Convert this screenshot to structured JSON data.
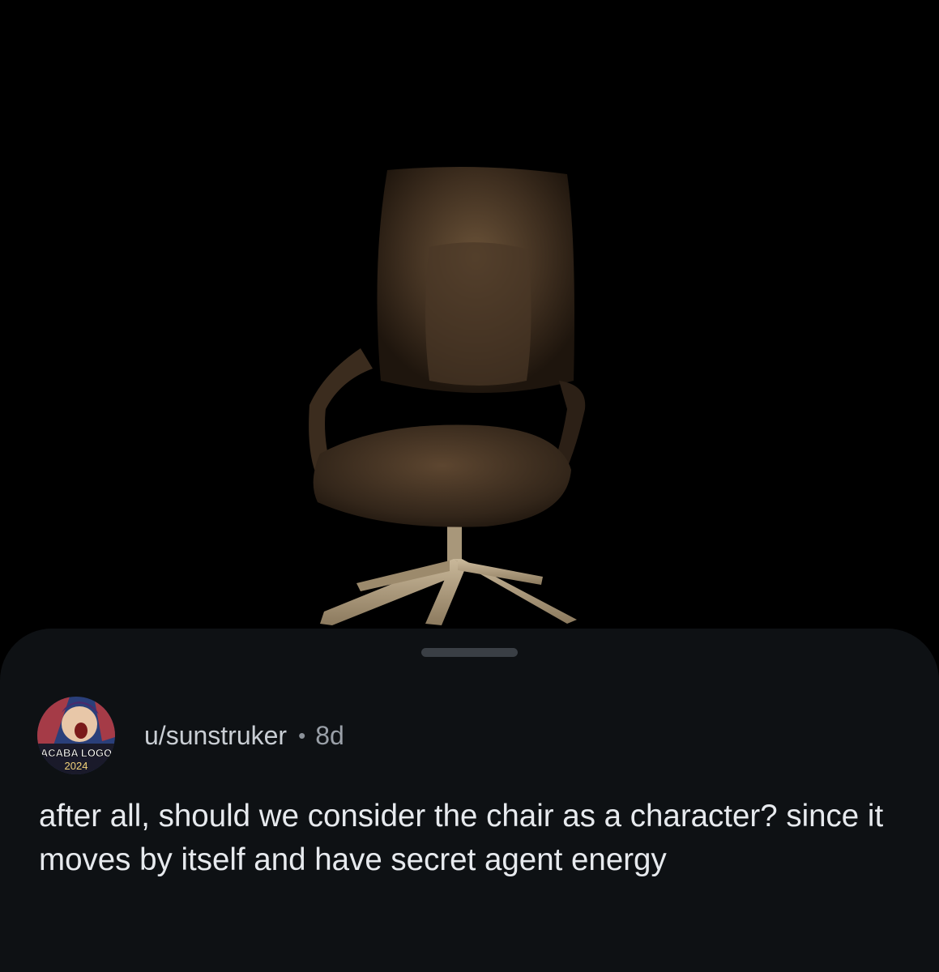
{
  "post": {
    "username": "u/sunstruker",
    "separator": "•",
    "age": "8d",
    "avatar_caption": "ACABA LOGO",
    "avatar_year": "2024",
    "body": "after all, should we consider the chair as a character? since it moves by itself and have secret agent energy"
  },
  "colors": {
    "background": "#000000",
    "sheet": "#0e1114",
    "handle": "#3a3f45",
    "username_text": "#c9ced4",
    "body_text": "#e7eaee"
  }
}
